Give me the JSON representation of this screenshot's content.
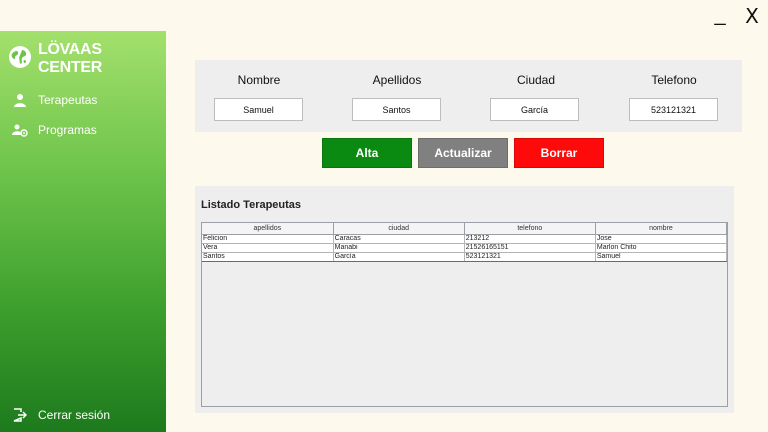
{
  "window": {
    "minimize_label": "_",
    "close_label": "X"
  },
  "sidebar": {
    "brand": "LÖVAAS CENTER",
    "items": [
      {
        "label": "Terapeutas",
        "icon": "person-icon"
      },
      {
        "label": "Programas",
        "icon": "people-gear-icon"
      }
    ],
    "logout": {
      "label": "Cerrar sesión",
      "icon": "logout-icon"
    }
  },
  "form": {
    "fields": [
      {
        "label": "Nombre",
        "value": "Samuel"
      },
      {
        "label": "Apellidos",
        "value": "Santos"
      },
      {
        "label": "Ciudad",
        "value": "García"
      },
      {
        "label": "Telefono",
        "value": "523121321"
      }
    ]
  },
  "actions": {
    "alta": "Alta",
    "actualizar": "Actualizar",
    "borrar": "Borrar"
  },
  "list": {
    "title": "Listado Terapeutas",
    "columns": [
      "apellidos",
      "ciudad",
      "telefono",
      "nombre"
    ],
    "rows": [
      [
        "Felicion",
        "Caracas",
        "213212",
        "Jose"
      ],
      [
        "Vera",
        "Manabi",
        "21526165151",
        "Marlon Chito"
      ],
      [
        "Santos",
        "García",
        "523121321",
        "Samuel"
      ]
    ]
  },
  "colors": {
    "alta": "#0a8a10",
    "actualizar": "#808080",
    "borrar": "#ff0a0a",
    "sidebar_top": "#a3e06c",
    "sidebar_bottom": "#1d7a1d"
  }
}
